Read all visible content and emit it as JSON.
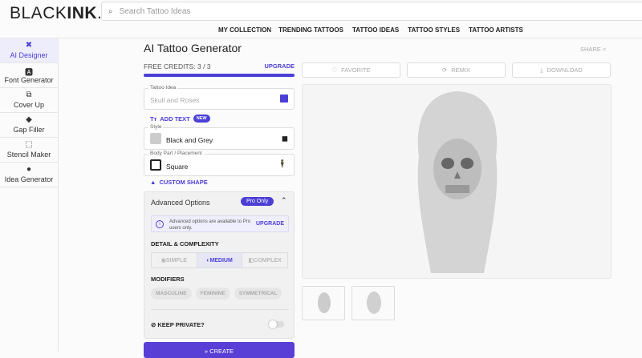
{
  "header": {
    "logo_light": "BLACK",
    "logo_bold": "INK",
    "logo_tail": ".AI",
    "search_placeholder": "Search Tattoo Ideas",
    "nav": [
      "MY COLLECTION",
      "TRENDING TATTOOS",
      "TATTOO IDEAS",
      "TATTOO STYLES",
      "TATTOO ARTISTS"
    ]
  },
  "sidebar": [
    {
      "label": "AI Designer",
      "icon": "✖"
    },
    {
      "label": "Font Generator",
      "icon": "🅰"
    },
    {
      "label": "Cover Up",
      "icon": "⧉"
    },
    {
      "label": "Gap Filler",
      "icon": "◆"
    },
    {
      "label": "Stencil Maker",
      "icon": "⬚"
    },
    {
      "label": "Idea Generator",
      "icon": "●"
    }
  ],
  "main": {
    "title": "AI Tattoo Generator",
    "credits_label": "FREE CREDITS: 3 / 3",
    "upgrade": "UPGRADE",
    "credits_fraction": 1.0,
    "idea_label": "Tattoo Idea",
    "idea_placeholder": "Skull and Roses",
    "add_text": "ADD TEXT",
    "new_badge": "NEW",
    "style_label": "Style",
    "style_value": "Black and Grey",
    "placement_label": "Body Part / Placement",
    "placement_value": "Square",
    "custom_shape": "CUSTOM SHAPE",
    "advanced": {
      "title": "Advanced Options",
      "pro": "Pro Only",
      "info": "Advanced options are available to Pro users only.",
      "upgrade": "UPGRADE",
      "detail_label": "DETAIL & COMPLEXITY",
      "detail_options": [
        "SIMPLE",
        "MEDIUM",
        "COMPLEX"
      ],
      "modifiers_label": "MODIFIERS",
      "modifiers": [
        "MASCULINE",
        "FEMININE",
        "SYMMETRICAL"
      ],
      "private_label": "KEEP PRIVATE?"
    },
    "create": "CREATE"
  },
  "result": {
    "share": "SHARE",
    "favorite": "FAVORITE",
    "remix": "REMIX",
    "download": "DOWNLOAD"
  }
}
